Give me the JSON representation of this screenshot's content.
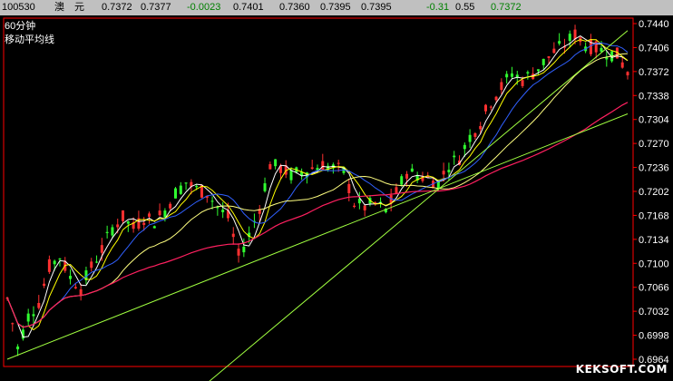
{
  "header": {
    "code": "100530",
    "name1": "澳",
    "name2": "元",
    "values": [
      {
        "text": "0.7372",
        "cls": "pos"
      },
      {
        "text": "0.7377",
        "cls": "pos"
      },
      {
        "text": "-0.0023",
        "cls": "neg"
      },
      {
        "text": "0.7401",
        "cls": "pos"
      },
      {
        "text": "0.7360",
        "cls": "pos"
      },
      {
        "text": "0.7395",
        "cls": "pos"
      },
      {
        "text": "0.7395",
        "cls": "pos"
      },
      {
        "text": "-0.31",
        "cls": "neg"
      },
      {
        "text": "0.55",
        "cls": "pos"
      },
      {
        "text": "0.7372",
        "cls": "neg"
      }
    ]
  },
  "chart_labels": {
    "period": "60分钟",
    "indicator": "移动平均线"
  },
  "watermark": "KEKSOFT.COM",
  "colors": {
    "background": "#000000",
    "frame": "#ff0000",
    "candle_up": "#ff3030",
    "candle_down": "#30ff30",
    "ma_fast": "#ffffff",
    "ma_short": "#ffff00",
    "ma_mid": "#3060ff",
    "ma_long": "#ffff80",
    "ma_longest": "#ff2060",
    "trendline": "#a0ff40"
  },
  "chart_data": {
    "type": "candlestick",
    "yticks": [
      "0.7440",
      "0.7406",
      "0.7372",
      "0.7338",
      "0.7304",
      "0.7270",
      "0.7236",
      "0.7202",
      "0.7168",
      "0.7134",
      "0.7100",
      "0.7066",
      "0.7032",
      "0.6998",
      "0.6964"
    ],
    "ylim": [
      0.6964,
      0.744
    ],
    "path": [
      [
        0,
        0.705
      ],
      [
        2,
        0.698
      ],
      [
        4,
        0.7025
      ],
      [
        6,
        0.7045
      ],
      [
        8,
        0.7095
      ],
      [
        10,
        0.711
      ],
      [
        12,
        0.708
      ],
      [
        14,
        0.7065
      ],
      [
        16,
        0.7095
      ],
      [
        18,
        0.712
      ],
      [
        20,
        0.715
      ],
      [
        22,
        0.7165
      ],
      [
        24,
        0.715
      ],
      [
        26,
        0.7165
      ],
      [
        28,
        0.716
      ],
      [
        30,
        0.7175
      ],
      [
        32,
        0.72
      ],
      [
        34,
        0.7215
      ],
      [
        36,
        0.7205
      ],
      [
        38,
        0.72
      ],
      [
        40,
        0.718
      ],
      [
        42,
        0.7165
      ],
      [
        44,
        0.711
      ],
      [
        46,
        0.714
      ],
      [
        48,
        0.718
      ],
      [
        50,
        0.724
      ],
      [
        52,
        0.7235
      ],
      [
        54,
        0.7225
      ],
      [
        56,
        0.723
      ],
      [
        58,
        0.7235
      ],
      [
        60,
        0.724
      ],
      [
        62,
        0.7235
      ],
      [
        64,
        0.723
      ],
      [
        66,
        0.7185
      ],
      [
        68,
        0.718
      ],
      [
        70,
        0.7185
      ],
      [
        72,
        0.7175
      ],
      [
        74,
        0.72
      ],
      [
        76,
        0.723
      ],
      [
        78,
        0.7225
      ],
      [
        80,
        0.722
      ],
      [
        82,
        0.7215
      ],
      [
        84,
        0.724
      ],
      [
        86,
        0.725
      ],
      [
        88,
        0.728
      ],
      [
        90,
        0.73
      ],
      [
        92,
        0.733
      ],
      [
        94,
        0.735
      ],
      [
        96,
        0.737
      ],
      [
        98,
        0.736
      ],
      [
        100,
        0.737
      ],
      [
        102,
        0.7385
      ],
      [
        104,
        0.74
      ],
      [
        106,
        0.741
      ],
      [
        108,
        0.7425
      ],
      [
        110,
        0.741
      ],
      [
        112,
        0.7405
      ],
      [
        114,
        0.74
      ],
      [
        116,
        0.7395
      ],
      [
        118,
        0.7372
      ]
    ],
    "trendlines": [
      {
        "from": [
          0,
          0.6964
        ],
        "to": [
          118,
          0.7312
        ]
      },
      {
        "from": [
          38,
          0.693
        ],
        "to": [
          118,
          0.743
        ]
      }
    ]
  }
}
